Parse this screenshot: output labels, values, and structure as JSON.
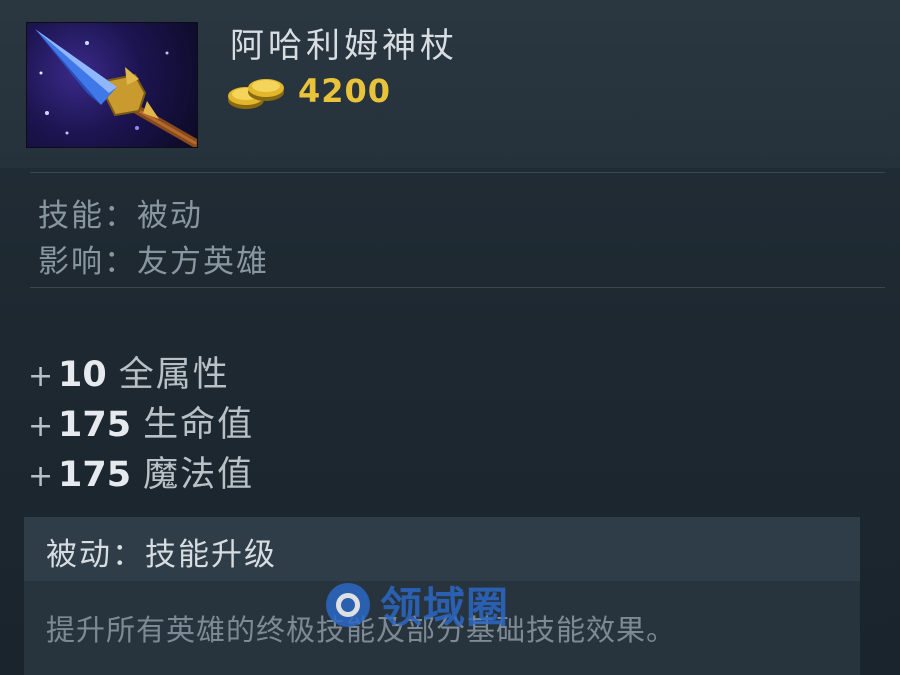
{
  "item": {
    "name": "阿哈利姆神杖",
    "cost": "4200",
    "icon": "aghanims-scepter-icon"
  },
  "info": {
    "skill": "技能：被动",
    "affects": "影响：友方英雄"
  },
  "attributes": [
    {
      "plus": "+",
      "value": "10",
      "label": "全属性"
    },
    {
      "plus": "+",
      "value": "175",
      "label": "生命值"
    },
    {
      "plus": "+",
      "value": "175",
      "label": "魔法值"
    }
  ],
  "ability": {
    "title": "被动：技能升级",
    "description": "提升所有英雄的终极技能及部分基础技能效果。"
  },
  "watermark": {
    "text": "领域圈",
    "icon": "watermark-logo-icon"
  },
  "colors": {
    "gold": "#e9c43a",
    "background": "#1c2730",
    "watermark": "#2c68c6"
  }
}
